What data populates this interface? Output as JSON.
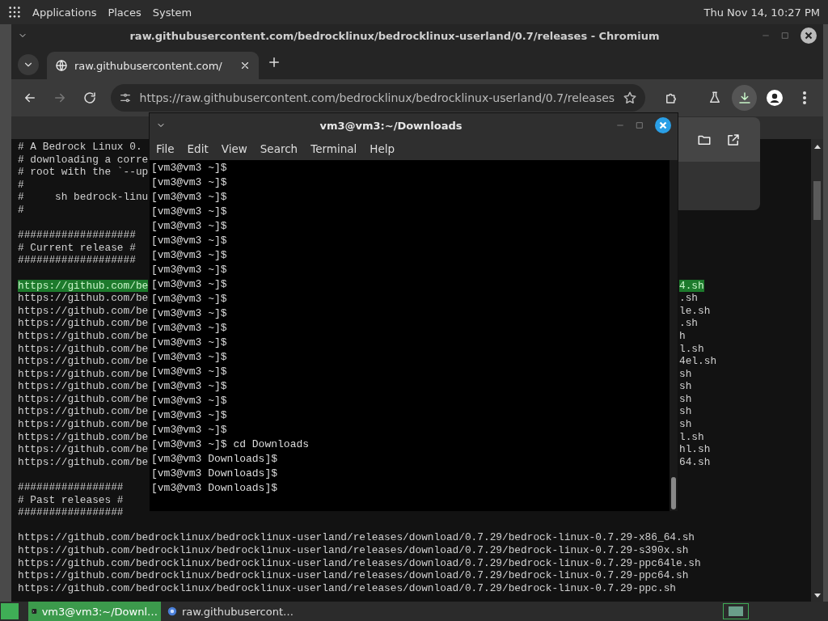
{
  "top_panel": {
    "menus": [
      "Applications",
      "Places",
      "System"
    ],
    "clock": "Thu Nov 14, 10:27 PM"
  },
  "browser": {
    "title": "raw.githubusercontent.com/bedrocklinux/bedrocklinux-userland/0.7/releases - Chromium",
    "tabs": [
      {
        "label": "raw.githubusercontent.com/",
        "selected": true
      }
    ],
    "address": "https://raw.githubusercontent.com/bedrocklinux/bedrocklinux-userland/0.7/releases",
    "page_blocks": [
      [
        {
          "text": "# A Bedrock Linux 0.",
          "highlighted": false
        },
        {
          "text": "# downloading a corre",
          "highlighted": false
        },
        {
          "text": "# root with the `--up",
          "highlighted": false
        },
        {
          "text": "#",
          "highlighted": false
        },
        {
          "text": "#     sh bedrock-linu",
          "highlighted": false
        },
        {
          "text": "#",
          "highlighted": false
        }
      ],
      [
        {
          "text": "###################",
          "highlighted": false
        },
        {
          "text": "# Current release #",
          "highlighted": false
        },
        {
          "text": "###################",
          "highlighted": false
        }
      ],
      [
        {
          "text": "https://github.com/be",
          "right": "4.sh",
          "highlighted": true
        },
        {
          "text": "https://github.com/be",
          "right": ".sh",
          "highlighted": false
        },
        {
          "text": "https://github.com/be",
          "right": "le.sh",
          "highlighted": false
        },
        {
          "text": "https://github.com/be",
          "right": ".sh",
          "highlighted": false
        },
        {
          "text": "https://github.com/be",
          "right": "h",
          "highlighted": false
        },
        {
          "text": "https://github.com/be",
          "right": "l.sh",
          "highlighted": false
        },
        {
          "text": "https://github.com/be",
          "right": "4el.sh",
          "highlighted": false
        },
        {
          "text": "https://github.com/be",
          "right": "sh",
          "highlighted": false
        },
        {
          "text": "https://github.com/be",
          "right": "sh",
          "highlighted": false
        },
        {
          "text": "https://github.com/be",
          "right": "sh",
          "highlighted": false
        },
        {
          "text": "https://github.com/be",
          "right": "sh",
          "highlighted": false
        },
        {
          "text": "https://github.com/be",
          "right": "sh",
          "highlighted": false
        },
        {
          "text": "https://github.com/be",
          "right": "l.sh",
          "highlighted": false
        },
        {
          "text": "https://github.com/be",
          "right": "hl.sh",
          "highlighted": false
        },
        {
          "text": "https://github.com/be",
          "right": "64.sh",
          "highlighted": false
        }
      ],
      [
        {
          "text": "#################",
          "highlighted": false
        },
        {
          "text": "# Past releases #",
          "highlighted": false
        },
        {
          "text": "#################",
          "highlighted": false
        }
      ],
      [
        {
          "text": "https://github.com/bedrocklinux/bedrocklinux-userland/releases/download/0.7.29/bedrock-linux-0.7.29-x86_64.sh",
          "highlighted": false
        },
        {
          "text": "https://github.com/bedrocklinux/bedrocklinux-userland/releases/download/0.7.29/bedrock-linux-0.7.29-s390x.sh",
          "highlighted": false
        },
        {
          "text": "https://github.com/bedrocklinux/bedrocklinux-userland/releases/download/0.7.29/bedrock-linux-0.7.29-ppc64le.sh",
          "highlighted": false
        },
        {
          "text": "https://github.com/bedrocklinux/bedrocklinux-userland/releases/download/0.7.29/bedrock-linux-0.7.29-ppc64.sh",
          "highlighted": false
        },
        {
          "text": "https://github.com/bedrocklinux/bedrocklinux-userland/releases/download/0.7.29/bedrock-linux-0.7.29-ppc.sh",
          "highlighted": false
        }
      ]
    ]
  },
  "terminal": {
    "title": "vm3@vm3:~/Downloads",
    "menu": [
      "File",
      "Edit",
      "View",
      "Search",
      "Terminal",
      "Help"
    ],
    "lines": [
      "[vm3@vm3 ~]$",
      "[vm3@vm3 ~]$",
      "[vm3@vm3 ~]$",
      "[vm3@vm3 ~]$",
      "[vm3@vm3 ~]$",
      "[vm3@vm3 ~]$",
      "[vm3@vm3 ~]$",
      "[vm3@vm3 ~]$",
      "[vm3@vm3 ~]$",
      "[vm3@vm3 ~]$",
      "[vm3@vm3 ~]$",
      "[vm3@vm3 ~]$",
      "[vm3@vm3 ~]$",
      "[vm3@vm3 ~]$",
      "[vm3@vm3 ~]$",
      "[vm3@vm3 ~]$",
      "[vm3@vm3 ~]$",
      "[vm3@vm3 ~]$",
      "[vm3@vm3 ~]$",
      "[vm3@vm3 ~]$ cd Downloads",
      "[vm3@vm3 Downloads]$",
      "[vm3@vm3 Downloads]$",
      "[vm3@vm3 Downloads]$"
    ]
  },
  "taskbar": {
    "tasks": [
      {
        "kind": "terminal",
        "label": "vm3@vm3:~/Downl…",
        "selected": true
      },
      {
        "kind": "browser",
        "label": "raw.githubusercont…",
        "selected": false
      }
    ]
  }
}
